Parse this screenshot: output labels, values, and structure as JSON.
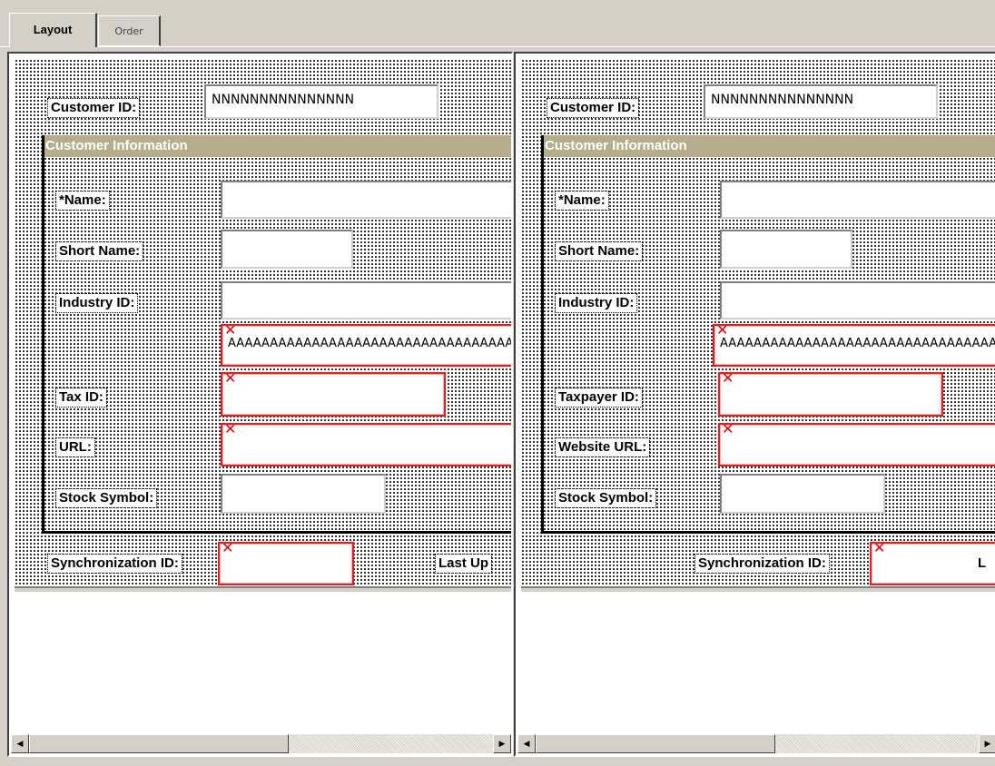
{
  "tabs": [
    {
      "label": "Layout",
      "active": true
    },
    {
      "label": "Order",
      "active": false
    }
  ],
  "left_pane": {
    "customer_id_label": "Customer ID:",
    "customer_id_value": "NNNNNNNNNNNNNNN",
    "group_title": "Customer Information",
    "name_label": "*Name:",
    "short_name_label": "Short Name:",
    "industry_id_label": "Industry ID:",
    "industry_desc_value": "AAAAAAAAAAAAAAAAAAAAAAAAAAAAAAAAAAAAAAAAAAAAAAA",
    "tax_id_label": "Tax ID:",
    "url_label": "URL:",
    "stock_symbol_label": "Stock Symbol:",
    "sync_id_label": "Synchronization ID:",
    "last_updated_label": "Last Up"
  },
  "right_pane": {
    "customer_id_label": "Customer ID:",
    "customer_id_value": "NNNNNNNNNNNNNNN",
    "group_title": "Customer Information",
    "name_label": "*Name:",
    "short_name_label": "Short Name:",
    "industry_id_label": "Industry ID:",
    "industry_desc_value": "AAAAAAAAAAAAAAAAAAAAAAAAAAAAAAAAAAAAAAAAAAAAAAA",
    "tax_id_label": "Taxpayer ID:",
    "url_label": "Website URL:",
    "stock_symbol_label": "Stock Symbol:",
    "sync_id_label": "Synchronization ID:",
    "last_updated_label": "L"
  },
  "icons": {
    "error_mark": "✕",
    "scroll_left": "◀",
    "scroll_right": "▶"
  },
  "colors": {
    "group_header": "#b6ad8d",
    "error_border": "#e02020",
    "window_bg": "#d4d0c8"
  }
}
